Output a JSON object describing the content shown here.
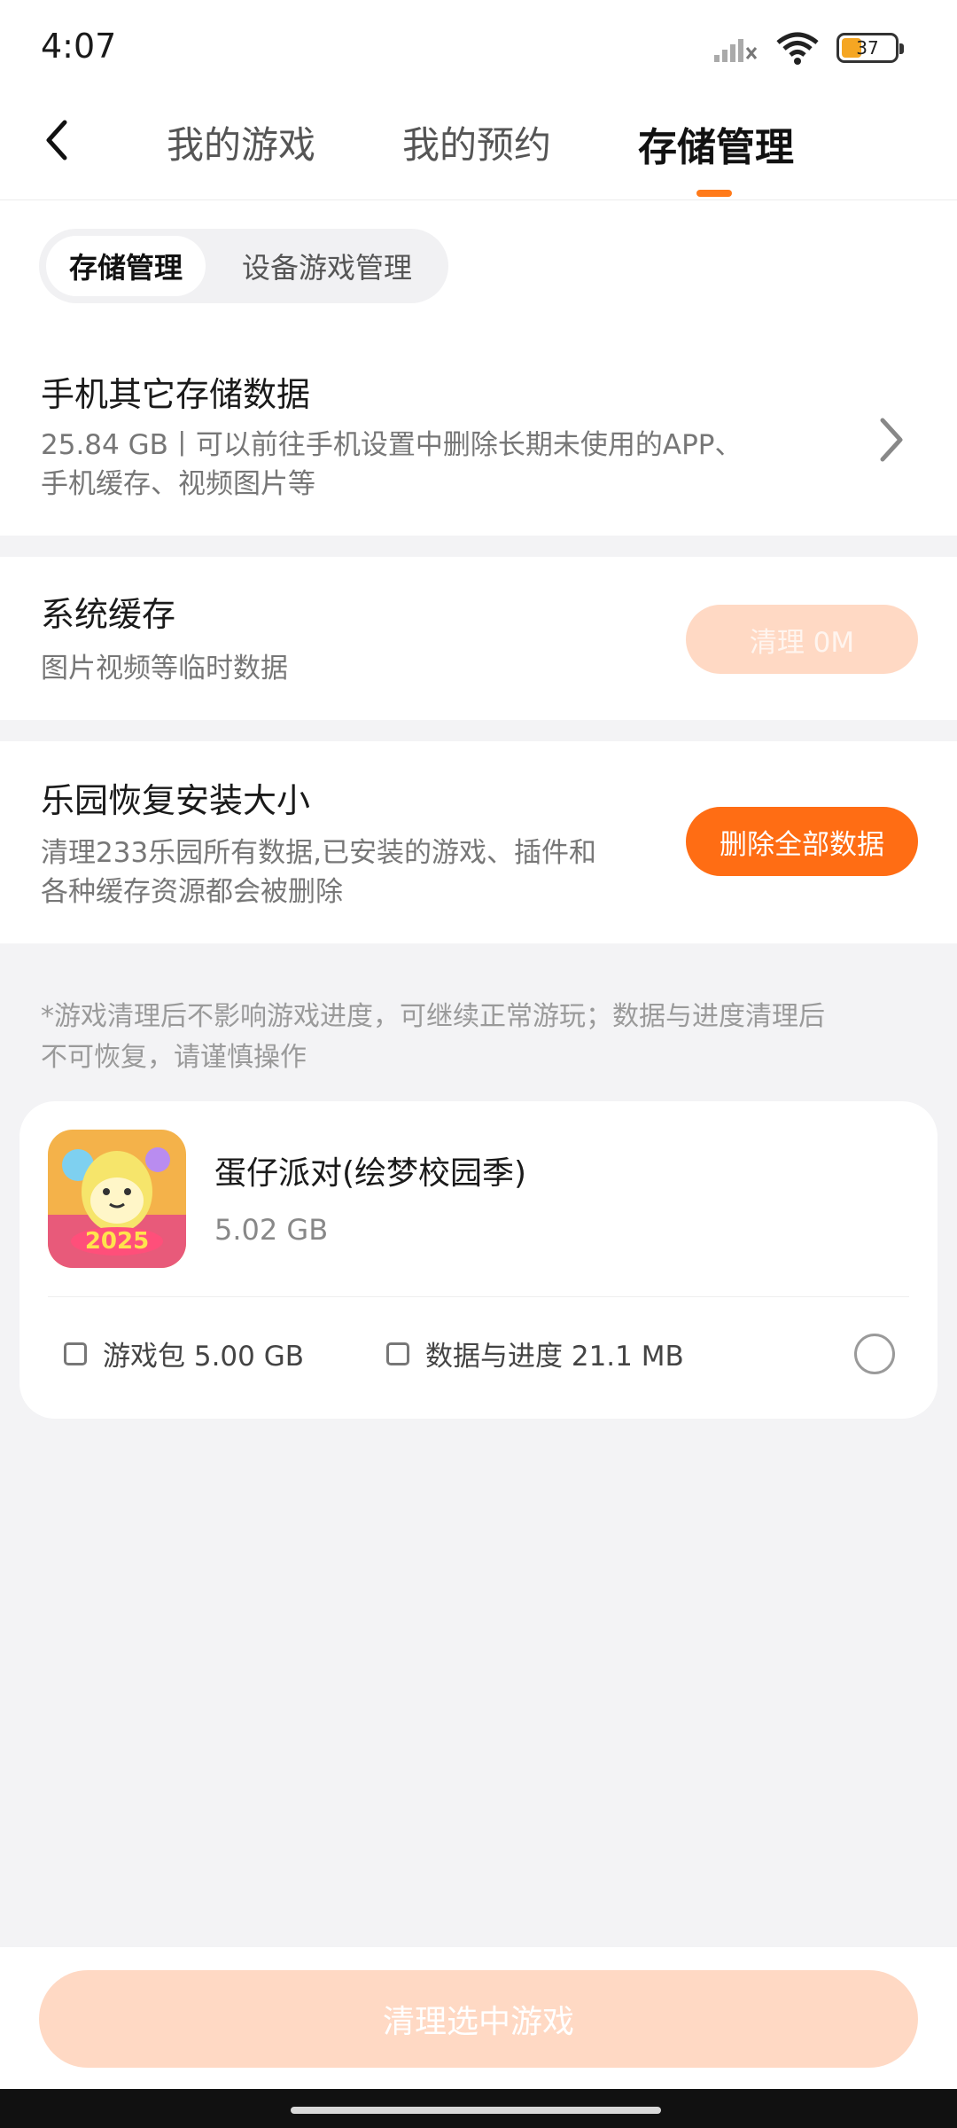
{
  "status_bar": {
    "time": "4:07",
    "battery": "37",
    "icons": [
      "signal-icon",
      "wifi-icon",
      "battery-icon"
    ]
  },
  "header": {
    "tabs": [
      {
        "label": "我的游戏",
        "active": false
      },
      {
        "label": "我的预约",
        "active": false
      },
      {
        "label": "存储管理",
        "active": true
      }
    ],
    "accent_color": "#ff7a1a"
  },
  "sub_tabs": [
    {
      "label": "存储管理",
      "active": true
    },
    {
      "label": "设备游戏管理",
      "active": false
    }
  ],
  "phone_storage": {
    "title": "手机其它存储数据",
    "desc_line1": "25.84 GB丨可以前往手机设置中删除长期未使用的APP、",
    "desc_line2": "手机缓存、视频图片等"
  },
  "system_cache": {
    "title": "系统缓存",
    "desc": "图片视频等临时数据",
    "button": "清理 0M"
  },
  "restore_size": {
    "title": "乐园恢复安装大小",
    "desc_line1": "清理233乐园所有数据,已安装的游戏、插件和",
    "desc_line2": "各种缓存资源都会被删除",
    "button": "删除全部数据"
  },
  "notice": {
    "line1": "*游戏清理后不影响游戏进度，可继续正常游玩；数据与进度清理后",
    "line2": "不可恢复，请谨慎操作"
  },
  "game": {
    "name": "蛋仔派对(绘梦校园季)",
    "size": "5.02 GB",
    "options": [
      {
        "label": "游戏包 5.00 GB",
        "checked": false
      },
      {
        "label": "数据与进度 21.1 MB",
        "checked": false
      }
    ],
    "selected": false
  },
  "bottom_button": "清理选中游戏"
}
